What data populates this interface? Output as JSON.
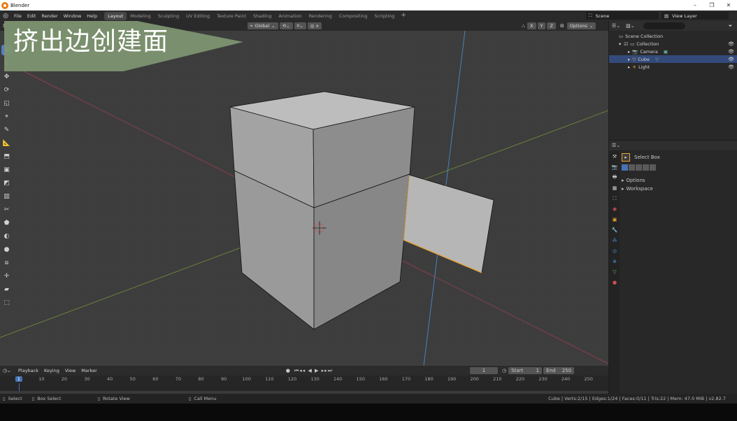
{
  "window": {
    "title": "Blender",
    "buttons": [
      "–",
      "❐",
      "✕"
    ]
  },
  "menu": [
    "File",
    "Edit",
    "Render",
    "Window",
    "Help"
  ],
  "workspace_tabs": [
    {
      "label": "Layout",
      "active": true
    },
    {
      "label": "Modeling",
      "active": false
    },
    {
      "label": "Sculpting",
      "active": false
    },
    {
      "label": "UV Editing",
      "active": false
    },
    {
      "label": "Texture Paint",
      "active": false
    },
    {
      "label": "Shading",
      "active": false
    },
    {
      "label": "Animation",
      "active": false
    },
    {
      "label": "Rendering",
      "active": false
    },
    {
      "label": "Compositing",
      "active": false
    },
    {
      "label": "Scripting",
      "active": false
    }
  ],
  "scene": {
    "name": "Scene",
    "view_layer": "View Layer"
  },
  "overlay_title": "挤出边创建面",
  "viewport": {
    "mode_label": "D:",
    "orientation": "Global",
    "axes": [
      "X",
      "Y",
      "Z"
    ],
    "options_label": "Options"
  },
  "outliner": {
    "root": "Scene Collection",
    "collection": "Collection",
    "items": [
      {
        "label": "Camera",
        "selected": false
      },
      {
        "label": "Cube",
        "selected": true
      },
      {
        "label": "Light",
        "selected": false
      }
    ]
  },
  "properties": {
    "tool_name": "Select Box",
    "sections": [
      "Options",
      "Workspace"
    ]
  },
  "timeline": {
    "menus": [
      "Playback",
      "Keying",
      "View",
      "Marker"
    ],
    "current_frame": "1",
    "start_label": "Start",
    "start": "1",
    "end_label": "End",
    "end": "250",
    "ticks": [
      "1",
      "10",
      "20",
      "30",
      "40",
      "50",
      "60",
      "70",
      "80",
      "90",
      "100",
      "110",
      "120",
      "130",
      "140",
      "150",
      "160",
      "170",
      "180",
      "190",
      "200",
      "210",
      "220",
      "230",
      "240",
      "250"
    ]
  },
  "status": {
    "select": "Select",
    "box_select": "Box Select",
    "rotate_view": "Rotate View",
    "call_menu": "Call Menu",
    "stats": "Cube | Verts:2/15 | Edges:1/24 | Faces:0/11 | Tris:22 | Mem: 47.0 MiB | v2.82.7"
  },
  "colors": {
    "accent": "#4772b3",
    "selected_edge": "#e8a336",
    "overlay_arrow": "#7d9370"
  }
}
